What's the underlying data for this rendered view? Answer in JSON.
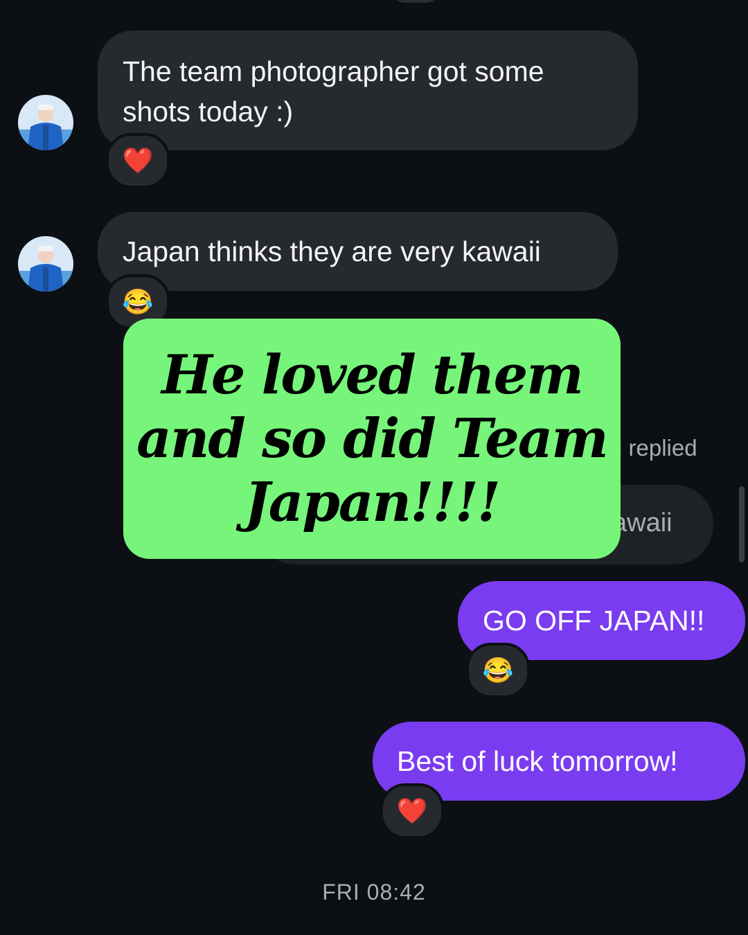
{
  "messages": [
    {
      "id": "m1",
      "text": "The team photographer got some shots today :)",
      "reaction": "❤️"
    },
    {
      "id": "m2",
      "text": "Japan thinks they are very kawaii",
      "reaction": "😂"
    }
  ],
  "reply_context": {
    "label_fragment": "u replied",
    "quoted_fragment": "awaii"
  },
  "sent": [
    {
      "id": "s1",
      "text": "GO OFF JAPAN!!",
      "reaction": "😂"
    },
    {
      "id": "s2",
      "text": "Best of luck tomorrow!",
      "reaction": "❤️"
    }
  ],
  "overlay": {
    "line1": "He loved them",
    "line2": "and so did Team",
    "line3": "Japan!!!!"
  },
  "timestamp": "FRI 08:42",
  "colors": {
    "background": "#0c1014",
    "incoming_bubble": "#262a2f",
    "outgoing_bubble": "#7a3cf0",
    "overlay_green": "#76f57a"
  }
}
